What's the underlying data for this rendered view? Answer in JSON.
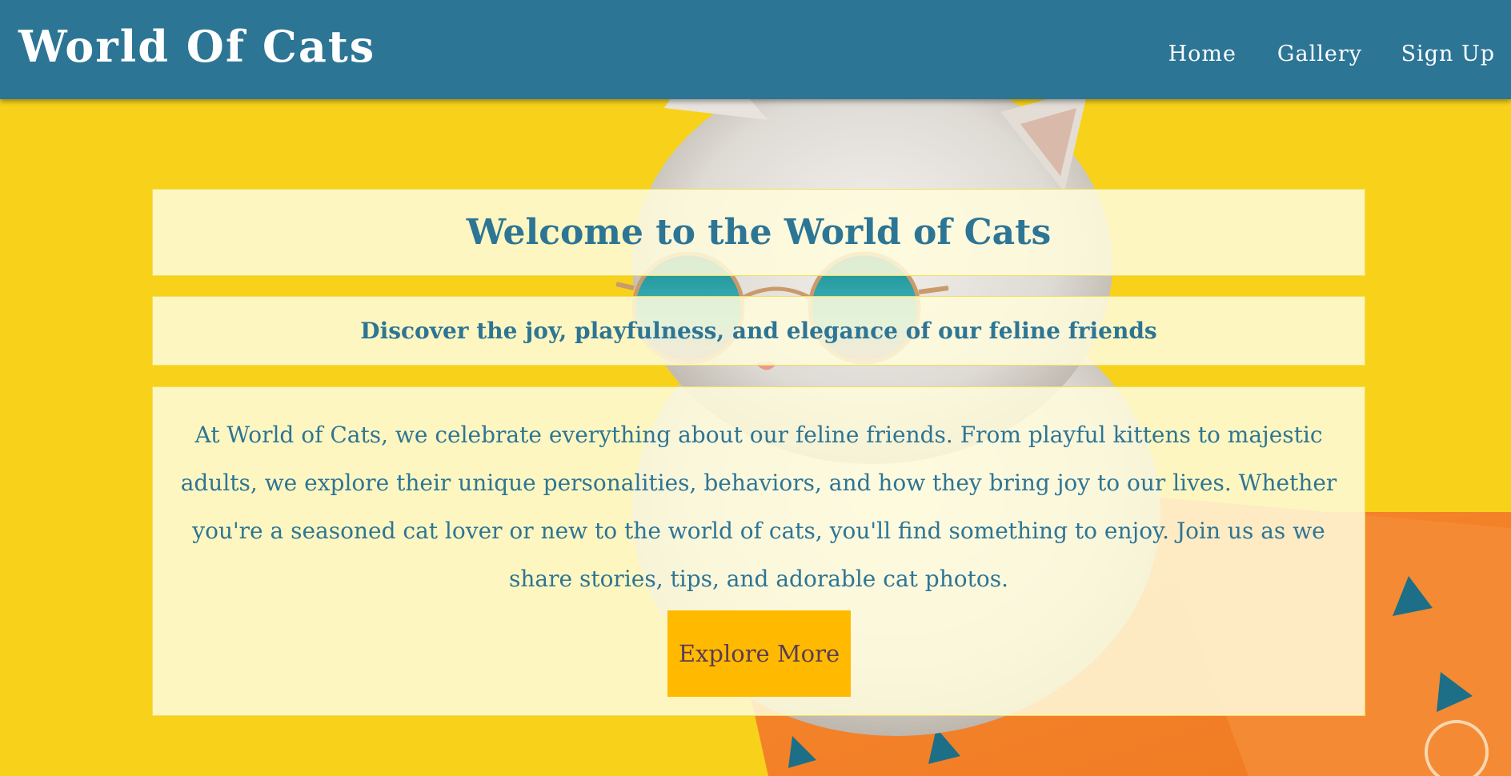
{
  "header": {
    "brand": "World Of Cats",
    "nav": [
      {
        "label": "Home"
      },
      {
        "label": "Gallery"
      },
      {
        "label": "Sign Up"
      }
    ]
  },
  "hero": {
    "title": "Welcome to the World of Cats",
    "subtitle": "Discover the joy, playfulness, and elegance of our feline friends",
    "body": "At World of Cats, we celebrate everything about our feline friends. From playful kittens to majestic adults, we explore their unique personalities, behaviors, and how they bring joy to our lives. Whether you're a seasoned cat lover or new to the world of cats, you'll find something to enjoy. Join us as we share stories, tips, and adorable cat photos.",
    "cta_label": "Explore More"
  },
  "colors": {
    "header_bg": "#2d7595",
    "page_bg": "#f8d21a",
    "panel_text": "#2d7595",
    "cta_bg": "#ffba00",
    "cta_text": "#5b3b55"
  },
  "icons": {
    "background": "cat-with-sunglasses-photo"
  }
}
